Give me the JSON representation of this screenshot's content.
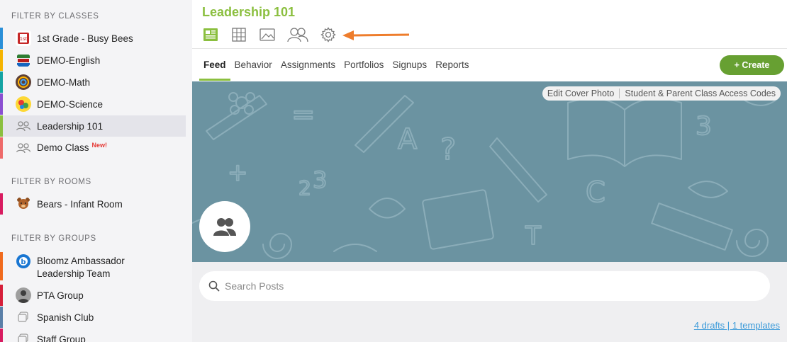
{
  "sidebar": {
    "classes_header": "FILTER BY CLASSES",
    "classes": [
      {
        "label": "1st Grade - Busy Bees",
        "color": "#2a8fd8",
        "icon": "book-icon"
      },
      {
        "label": "DEMO-English",
        "color": "#f5b400",
        "icon": "books-stack-icon"
      },
      {
        "label": "DEMO-Math",
        "color": "#14a3a3",
        "icon": "math-circle-icon"
      },
      {
        "label": "DEMO-Science",
        "color": "#8a4fd1",
        "icon": "science-icon"
      },
      {
        "label": "Leadership 101",
        "color": "#8bbf3f",
        "icon": "people-icon"
      },
      {
        "label": "Demo Class",
        "badge": "New!",
        "color": "#ee6a6a",
        "icon": "people-icon"
      }
    ],
    "rooms_header": "FILTER BY ROOMS",
    "rooms": [
      {
        "label": "Bears - Infant Room",
        "color": "#d81b60",
        "icon": "bear-icon"
      }
    ],
    "groups_header": "FILTER BY GROUPS",
    "groups": [
      {
        "label_line1": "Bloomz Ambassador",
        "label_line2": "Leadership Team",
        "color": "#f06a1d",
        "icon": "bloomz-logo-icon"
      },
      {
        "label": "PTA Group",
        "color": "#d61f3a",
        "icon": "person-avatar-icon"
      },
      {
        "label": "Spanish Club",
        "color": "#5a7fa8",
        "icon": "chat-bubble-icon"
      },
      {
        "label": "Staff Group",
        "color": "#d81b60",
        "icon": "chat-bubble-icon"
      }
    ]
  },
  "header": {
    "title": "Leadership 101",
    "toolbar": [
      "feed-icon",
      "table-icon",
      "image-icon",
      "people-icon",
      "gear-icon"
    ],
    "arrow_color": "#ee7d2c"
  },
  "tabs": [
    "Feed",
    "Behavior",
    "Assignments",
    "Portfolios",
    "Signups",
    "Reports"
  ],
  "active_tab": "Feed",
  "create_label": "+ Create",
  "cover": {
    "edit_label": "Edit Cover Photo",
    "codes_label": "Student & Parent Class Access Codes",
    "bg_color": "#6b93a1"
  },
  "search": {
    "placeholder": "Search Posts"
  },
  "drafts_label": "4 drafts | 1 templates",
  "colors": {
    "accent_green": "#8bbf3f",
    "create_green": "#67a032",
    "link_blue": "#3b9ad9"
  }
}
